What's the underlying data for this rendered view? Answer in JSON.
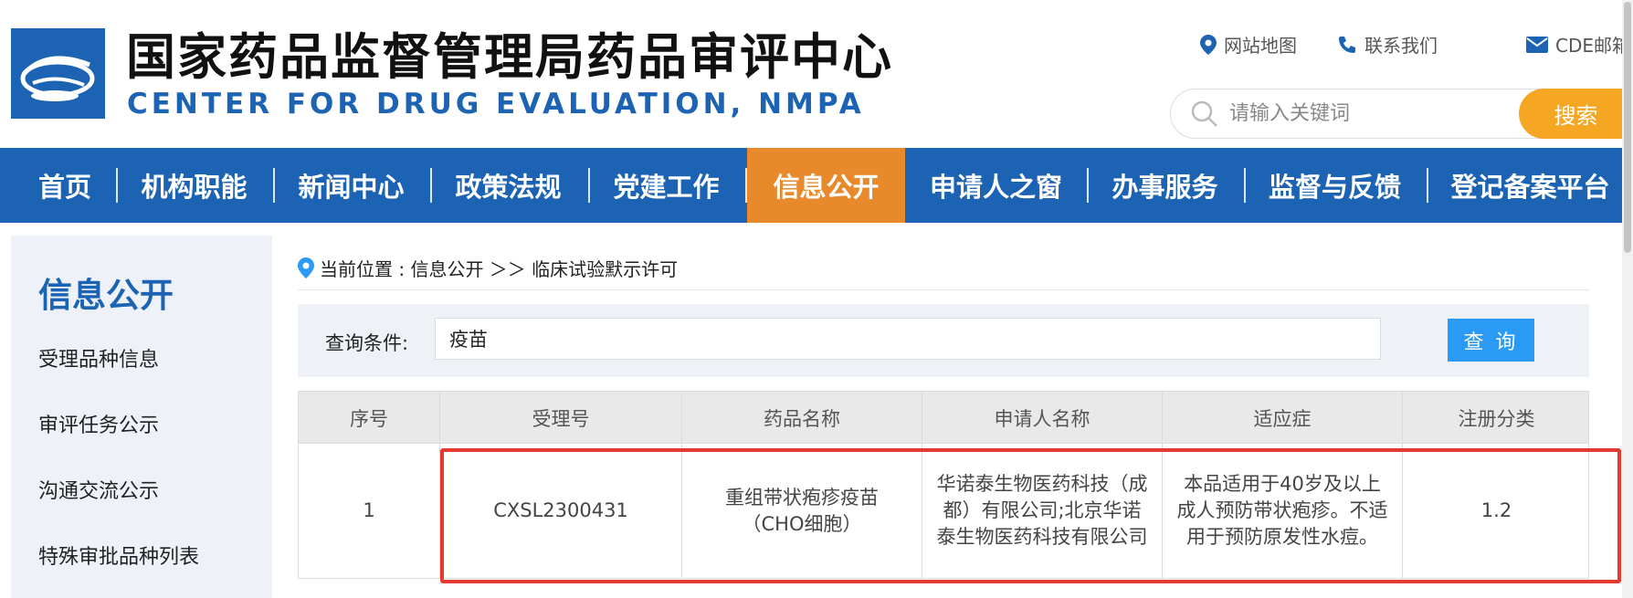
{
  "header": {
    "title": "国家药品监督管理局药品审评中心",
    "subtitle": "CENTER FOR DRUG EVALUATION, NMPA",
    "links": [
      {
        "label": "网站地图",
        "icon": "map-pin-icon"
      },
      {
        "label": "联系我们",
        "icon": "phone-icon"
      },
      {
        "label": "CDE邮箱",
        "icon": "mail-icon"
      }
    ],
    "search": {
      "placeholder": "请输入关键词",
      "button_label": "搜索"
    }
  },
  "nav": {
    "items": [
      {
        "label": "首页"
      },
      {
        "label": "机构职能"
      },
      {
        "label": "新闻中心"
      },
      {
        "label": "政策法规"
      },
      {
        "label": "党建工作"
      },
      {
        "label": "信息公开"
      },
      {
        "label": "申请人之窗"
      },
      {
        "label": "办事服务"
      },
      {
        "label": "监督与反馈"
      },
      {
        "label": "登记备案平台"
      }
    ],
    "active": "信息公开"
  },
  "sidebar": {
    "title": "信息公开",
    "items": [
      {
        "label": "受理品种信息"
      },
      {
        "label": "审评任务公示"
      },
      {
        "label": "沟通交流公示"
      },
      {
        "label": "特殊审批品种列表"
      }
    ]
  },
  "breadcrumb": {
    "text": "当前位置 : 信息公开 ＞＞ 临床试验默示许可"
  },
  "query": {
    "label": "查询条件:",
    "value": "疫苗",
    "button_label": "查 询"
  },
  "table": {
    "headers": [
      "序号",
      "受理号",
      "药品名称",
      "申请人名称",
      "适应症",
      "注册分类"
    ],
    "rows": [
      [
        "1",
        "CXSL2300431",
        "重组带状疱疹疫苗（CHO细胞）",
        "华诺泰生物医药科技（成都）有限公司;北京华诺泰生物医药科技有限公司",
        "本品适用于40岁及以上成人预防带状疱疹。不适用于预防原发性水痘。",
        "1.2"
      ]
    ]
  },
  "colors": {
    "brand_blue": "#1c64b3",
    "active_orange": "#e8892b",
    "search_orange": "#f5a623",
    "query_blue": "#2a9af5",
    "highlight_red": "#e53a2e"
  }
}
